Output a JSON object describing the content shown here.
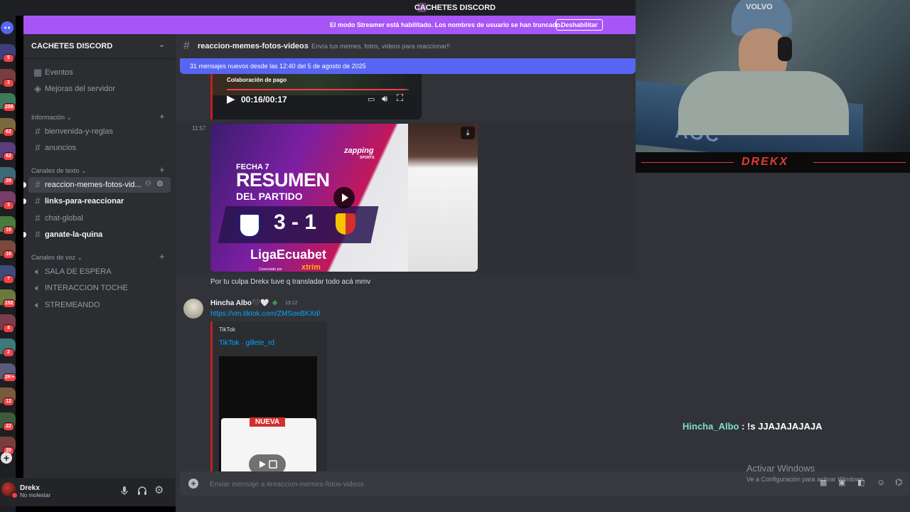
{
  "window": {
    "title": "CACHETES DISCORD"
  },
  "streamer_banner": {
    "text": "El modo Streamer está habilitado. Los nombres de usuario se han truncado.",
    "button": "Deshabilitar"
  },
  "server": {
    "name": "CACHETES DISCORD"
  },
  "rail_badges": [
    "5",
    "3",
    "288",
    "62",
    "62",
    "26",
    "3",
    "16",
    "16",
    "7",
    "192",
    "4",
    "2",
    "2K+",
    "12",
    "22",
    "20"
  ],
  "sidebar": {
    "top_items": [
      {
        "label": "Eventos",
        "icon": "calendar-icon"
      },
      {
        "label": "Mejoras del servidor",
        "icon": "boost-icon"
      }
    ],
    "categories": [
      {
        "name": "Información",
        "channels": [
          {
            "label": "bienvenida-y-reglas",
            "type": "text"
          },
          {
            "label": "anuncios",
            "type": "text"
          }
        ]
      },
      {
        "name": "Canales de texto",
        "channels": [
          {
            "label": "reaccion-memes-fotos-vid...",
            "type": "text",
            "active": true
          },
          {
            "label": "links-para-reaccionar",
            "type": "text",
            "unread": true
          },
          {
            "label": "chat-global",
            "type": "text"
          },
          {
            "label": "ganate-la-quina",
            "type": "text",
            "unread": true
          }
        ]
      },
      {
        "name": "Canales de voz",
        "channels": [
          {
            "label": "SALA DE ESPERA",
            "type": "voice"
          },
          {
            "label": "INTERACCION TOCHE",
            "type": "voice"
          },
          {
            "label": "STREMEANDO",
            "type": "voice"
          }
        ]
      }
    ]
  },
  "user": {
    "name": "Drekx",
    "status": "No molestar"
  },
  "channel": {
    "name": "reaccion-memes-fotos-videos",
    "topic": "Envía tus memes, fotos, videos para reaccionar!!"
  },
  "new_messages": "31 mensajes nuevos desde las 12:40 del 5 de agosto de 2025",
  "messages": {
    "video1": {
      "paid_label": "Colaboración de pago",
      "time": "00:16/00:17"
    },
    "img_time": "11:57",
    "thumb": {
      "fecha": "FECHA 7",
      "resumen": "RESUMEN",
      "del_partido": "DEL PARTIDO",
      "score": "3 - 1",
      "brand": "zapping",
      "brand_sub": "SPORTS",
      "league": "LigaEcuabet",
      "sponsor": "xtrim",
      "sponsor_pre": "Conectado por"
    },
    "caption": "Por tu culpa Drekx tuve q transladar todo acá mmv",
    "reply": {
      "author": "Hincha Albo🖤🤍",
      "time": "13:12",
      "link": "https://vm.tiktok.com/ZMSoeBKXd/",
      "embed_provider": "TikTok",
      "embed_title": "TikTok · gillete_rd",
      "embed_badge": "NUEVA"
    }
  },
  "composer": {
    "placeholder": "Enviar mensaje a #reaccion-memes-fotos-videos"
  },
  "overlay": {
    "chat_user": "Hincha_Albo",
    "chat_text": ": !s JJAJAJAJAJA",
    "webcam_label": "DREKX",
    "cap_text": "VOLVO",
    "monitor_text": "AOC",
    "activate_title": "Activar Windows",
    "activate_sub": "Ve a Configuración para activar Windows."
  }
}
